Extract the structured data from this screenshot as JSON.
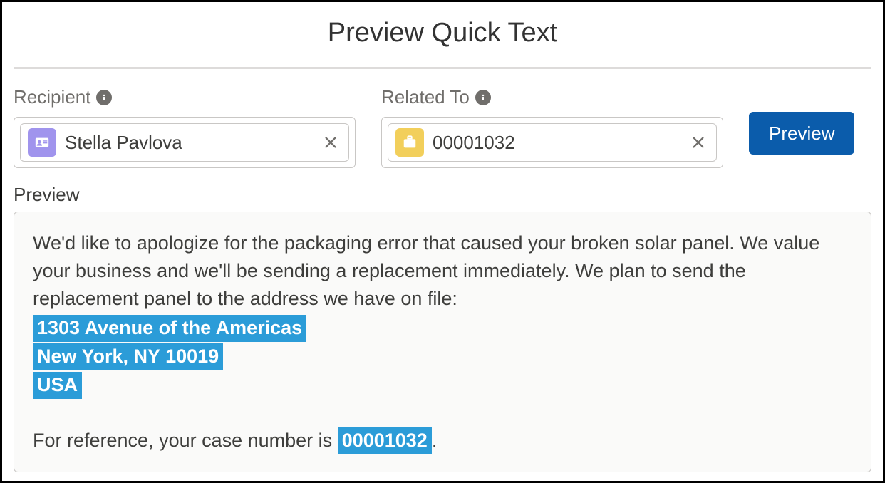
{
  "title": "Preview Quick Text",
  "recipient": {
    "label": "Recipient",
    "value": "Stella Pavlova"
  },
  "relatedTo": {
    "label": "Related To",
    "value": "00001032"
  },
  "previewButton": "Preview",
  "previewSection": {
    "label": "Preview",
    "body_intro": "We'd like to apologize for the packaging error that caused your broken solar panel. We value your business and we'll be sending a replacement immediately. We plan to send the replacement panel to the address we have on file:",
    "address_line1": "1303 Avenue of the Americas ",
    "address_line2": "New York, NY 10019",
    "address_line3": "USA ",
    "reference_prefix": "For reference, your case number is ",
    "reference_case": "00001032 ",
    "reference_suffix": "."
  }
}
